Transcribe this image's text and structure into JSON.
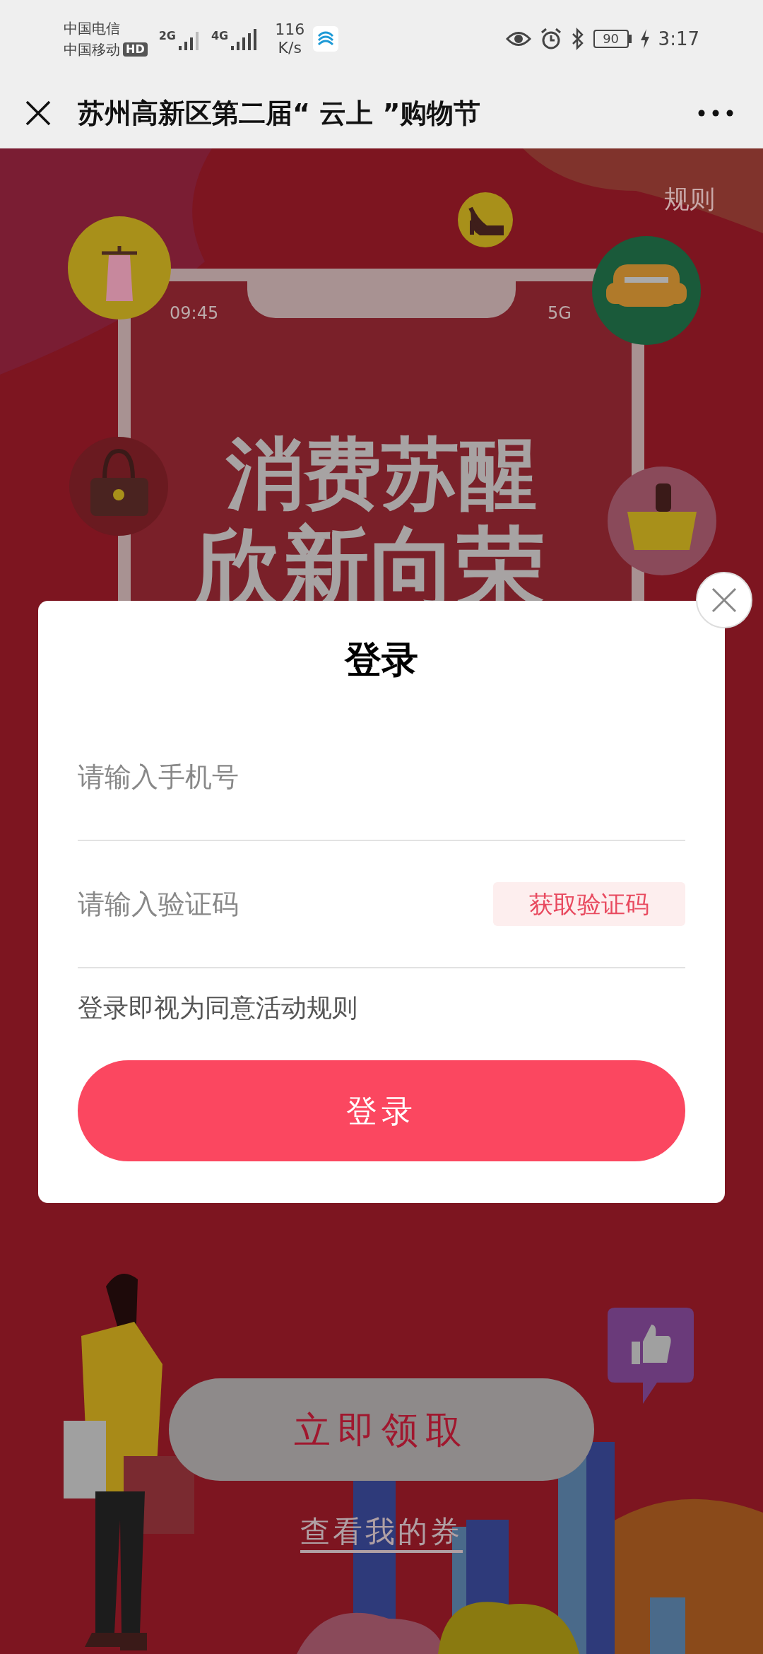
{
  "status_bar": {
    "carrier_1": "中国电信",
    "carrier_2": "中国移动",
    "hd_badge": "HD",
    "network_1": "2G",
    "network_2": "4G",
    "speed": "116",
    "speed_unit": "K/s",
    "battery": "90",
    "time": "3:17"
  },
  "nav_bar": {
    "title": "苏州高新区第二届“ 云上 ”购物节"
  },
  "poster": {
    "rules_link": "规则",
    "phone_time": "09:45",
    "phone_network": "5G",
    "headline_1": "消费苏醒",
    "headline_2": "欣新向荣",
    "claim_button": "立即领取",
    "coupons_link": "查看我的券"
  },
  "login_dialog": {
    "title": "登录",
    "fields": [
      {
        "placeholder": "请输入手机号"
      },
      {
        "placeholder": "请输入验证码",
        "action": "获取验证码"
      }
    ],
    "agreement": "登录即视为同意活动规则",
    "submit": "登录"
  }
}
